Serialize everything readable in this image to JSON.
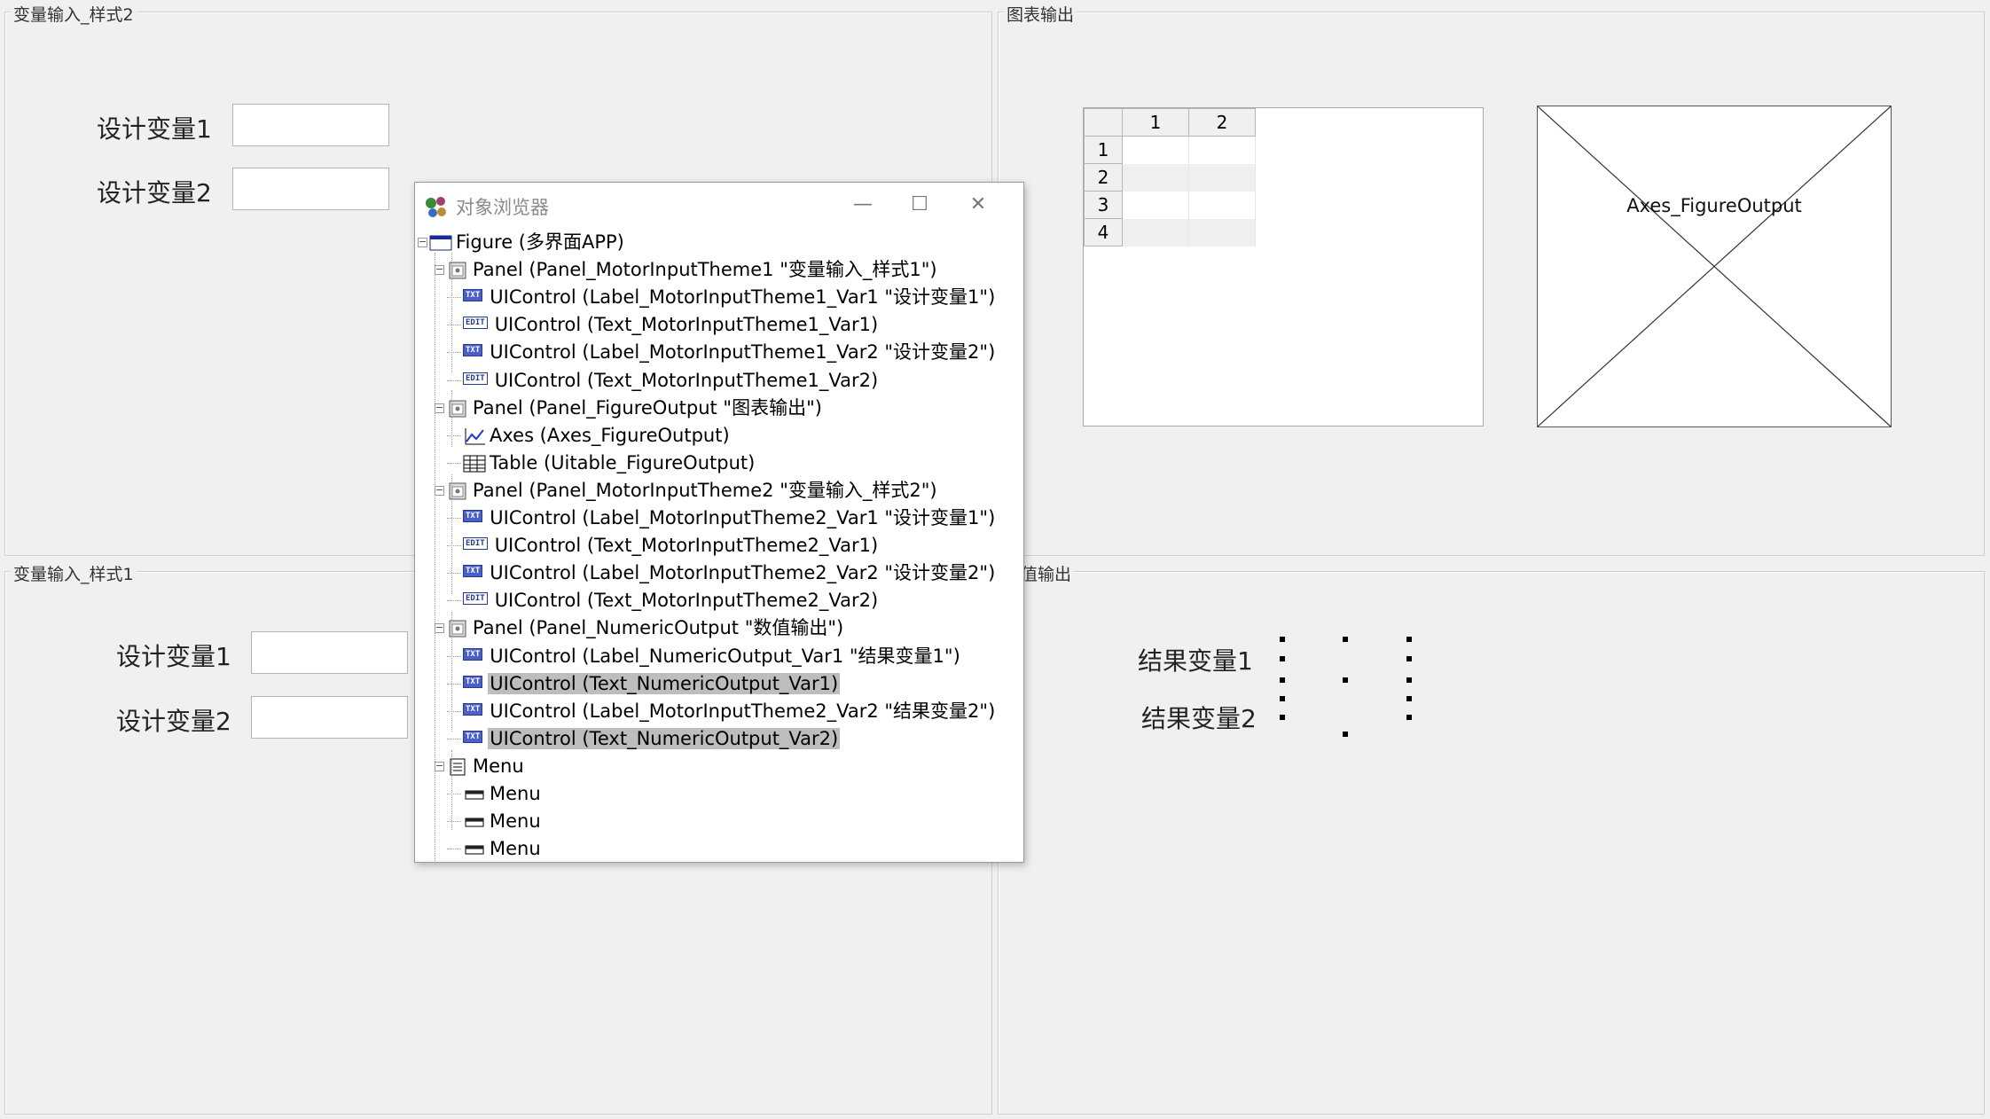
{
  "panels": {
    "motor_input_theme2": {
      "title": "变量输入_样式2",
      "var1_label": "设计变量1",
      "var2_label": "设计变量2",
      "var1_value": "",
      "var2_value": ""
    },
    "figure_output": {
      "title": "图表输出"
    },
    "motor_input_theme1": {
      "title": "变量输入_样式1",
      "var1_label": "设计变量1",
      "var2_label": "设计变量2",
      "var1_value": "",
      "var2_value": ""
    },
    "numeric_output": {
      "title": "值输出",
      "var1_label": "结果变量1",
      "var2_label": "结果变量2"
    }
  },
  "table": {
    "columns": [
      "1",
      "2"
    ],
    "rows": [
      "1",
      "2",
      "3",
      "4"
    ]
  },
  "axes": {
    "label": "Axes_FigureOutput"
  },
  "object_browser": {
    "title": "对象浏览器",
    "minimize": "—",
    "maximize": "☐",
    "close": "✕",
    "nodes": [
      {
        "text": "Figure (多界面APP)",
        "level": 0,
        "icon": "figure-icon",
        "expander": "−"
      },
      {
        "text": "Panel (Panel_MotorInputTheme1 \"变量输入_样式1\")",
        "level": 1,
        "icon": "panel-icon",
        "expander": "−"
      },
      {
        "text": "UIControl (Label_MotorInputTheme1_Var1 \"设计变量1\")",
        "level": 2,
        "icon": "txt-icon"
      },
      {
        "text": "UIControl (Text_MotorInputTheme1_Var1)",
        "level": 2,
        "icon": "edit-icon"
      },
      {
        "text": "UIControl (Label_MotorInputTheme1_Var2 \"设计变量2\")",
        "level": 2,
        "icon": "txt-icon"
      },
      {
        "text": "UIControl (Text_MotorInputTheme1_Var2)",
        "level": 2,
        "icon": "edit-icon"
      },
      {
        "text": "Panel (Panel_FigureOutput \"图表输出\")",
        "level": 1,
        "icon": "panel-icon",
        "expander": "−"
      },
      {
        "text": "Axes (Axes_FigureOutput)",
        "level": 2,
        "icon": "axes-icon"
      },
      {
        "text": "Table (Uitable_FigureOutput)",
        "level": 2,
        "icon": "table-icon"
      },
      {
        "text": "Panel (Panel_MotorInputTheme2 \"变量输入_样式2\")",
        "level": 1,
        "icon": "panel-icon",
        "expander": "−"
      },
      {
        "text": "UIControl (Label_MotorInputTheme2_Var1 \"设计变量1\")",
        "level": 2,
        "icon": "txt-icon"
      },
      {
        "text": "UIControl (Text_MotorInputTheme2_Var1)",
        "level": 2,
        "icon": "edit-icon"
      },
      {
        "text": "UIControl (Label_MotorInputTheme2_Var2 \"设计变量2\")",
        "level": 2,
        "icon": "txt-icon"
      },
      {
        "text": "UIControl (Text_MotorInputTheme2_Var2)",
        "level": 2,
        "icon": "edit-icon"
      },
      {
        "text": "Panel (Panel_NumericOutput \"数值输出\")",
        "level": 1,
        "icon": "panel-icon",
        "expander": "−"
      },
      {
        "text": "UIControl (Label_NumericOutput_Var1 \"结果变量1\")",
        "level": 2,
        "icon": "txt-icon"
      },
      {
        "text": "UIControl (Text_NumericOutput_Var1)",
        "level": 2,
        "icon": "txt-icon",
        "selected": true
      },
      {
        "text": "UIControl (Label_MotorInputTheme2_Var2 \"结果变量2\")",
        "level": 2,
        "icon": "txt-icon"
      },
      {
        "text": "UIControl (Text_NumericOutput_Var2)",
        "level": 2,
        "icon": "txt-icon",
        "selected": true
      },
      {
        "text": "Menu",
        "level": 1,
        "icon": "menu-icon",
        "expander": "−"
      },
      {
        "text": "Menu",
        "level": 2,
        "icon": "menu-item-icon"
      },
      {
        "text": "Menu",
        "level": 2,
        "icon": "menu-item-icon"
      },
      {
        "text": "Menu",
        "level": 2,
        "icon": "menu-item-icon"
      }
    ]
  }
}
